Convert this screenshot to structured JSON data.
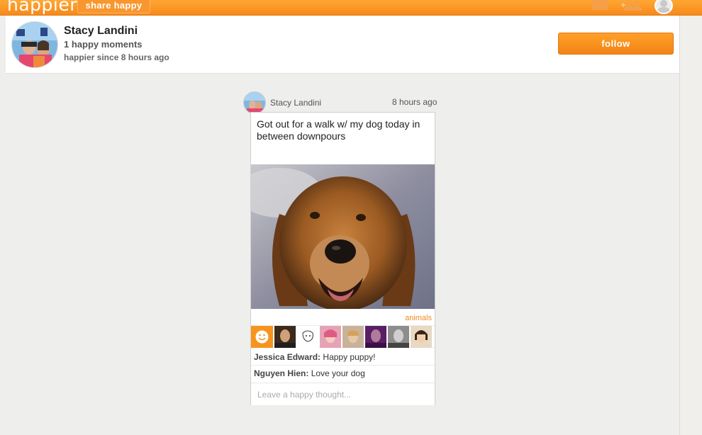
{
  "app": {
    "logo": "happier",
    "share_label": "share happy"
  },
  "profile": {
    "name": "Stacy Landini",
    "moments": "1 happy moments",
    "since": "happier since 8 hours ago",
    "follow_label": "follow"
  },
  "post": {
    "author": "Stacy Landini",
    "time": "8 hours ago",
    "text": "Got out for a walk w/ my dog today in between downpours",
    "tag": "animals",
    "reactions": [
      "smile-icon",
      "avatar",
      "doodle",
      "avatar",
      "avatar",
      "avatar",
      "avatar",
      "avatar"
    ],
    "comments": [
      {
        "author": "Jessica Edward:",
        "text": "Happy puppy!"
      },
      {
        "author": "Nguyen Hien:",
        "text": "Love your dog"
      }
    ],
    "comment_placeholder": "Leave a happy thought..."
  },
  "colors": {
    "accent": "#f7941d",
    "tag": "#f28a1e",
    "background": "#eeeeec"
  }
}
